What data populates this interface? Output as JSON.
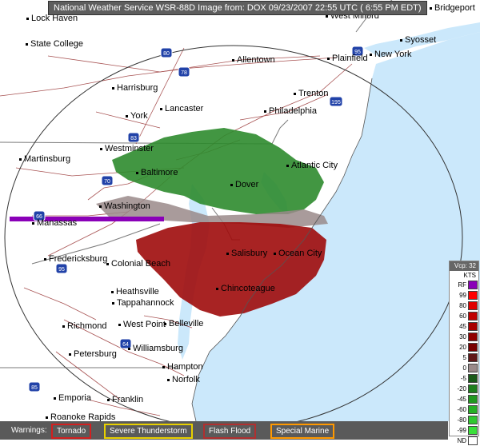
{
  "header": {
    "title": "National Weather Service WSR-88D Image from: DOX 09/23/2007  22:55 UTC ( 6:55 PM EDT)"
  },
  "cities": [
    {
      "name": "State College"
    },
    {
      "name": "Harrisburg"
    },
    {
      "name": "York"
    },
    {
      "name": "Lancaster"
    },
    {
      "name": "Allentown"
    },
    {
      "name": "Trenton"
    },
    {
      "name": "Philadelphia"
    },
    {
      "name": "Plainfield"
    },
    {
      "name": "New York"
    },
    {
      "name": "Syosset"
    },
    {
      "name": "Westminster"
    },
    {
      "name": "Martinsburg"
    },
    {
      "name": "Baltimore"
    },
    {
      "name": "Dover"
    },
    {
      "name": "Atlantic City"
    },
    {
      "name": "Washington"
    },
    {
      "name": "Manassas"
    },
    {
      "name": "Fredericksburg"
    },
    {
      "name": "Colonial Beach"
    },
    {
      "name": "Salisbury"
    },
    {
      "name": "Ocean City"
    },
    {
      "name": "Chincoteague"
    },
    {
      "name": "Heathsville"
    },
    {
      "name": "Tappahannock"
    },
    {
      "name": "Richmond"
    },
    {
      "name": "West Point"
    },
    {
      "name": "Belleville"
    },
    {
      "name": "Williamsburg"
    },
    {
      "name": "Petersburg"
    },
    {
      "name": "Hampton"
    },
    {
      "name": "Norfolk"
    },
    {
      "name": "Emporia"
    },
    {
      "name": "Franklin"
    },
    {
      "name": "Roanoke Rapids"
    },
    {
      "name": "West Milford"
    },
    {
      "name": "Bridgeport"
    },
    {
      "name": "Lock Haven"
    }
  ],
  "interstates": [
    "80",
    "78",
    "83",
    "70",
    "66",
    "95",
    "195",
    "64",
    "85",
    "95"
  ],
  "legend": {
    "title": "Vcp: 32",
    "units": "KTS",
    "entries": [
      {
        "label": "RF",
        "color": "#8a00b8"
      },
      {
        "label": "99",
        "color": "#ff0000"
      },
      {
        "label": "80",
        "color": "#e00000"
      },
      {
        "label": "60",
        "color": "#c00000"
      },
      {
        "label": "45",
        "color": "#a80000"
      },
      {
        "label": "30",
        "color": "#900000"
      },
      {
        "label": "20",
        "color": "#780000"
      },
      {
        "label": "5",
        "color": "#601818"
      },
      {
        "label": "0",
        "color": "#9a8a8a"
      },
      {
        "label": "-5",
        "color": "#1a5a1a"
      },
      {
        "label": "-20",
        "color": "#1f7f1f"
      },
      {
        "label": "-45",
        "color": "#229922"
      },
      {
        "label": "-60",
        "color": "#27b027"
      },
      {
        "label": "-80",
        "color": "#30c830"
      },
      {
        "label": "-99",
        "color": "#3ae03a"
      },
      {
        "label": "ND",
        "color": "#ffffff"
      }
    ]
  },
  "warnings": {
    "label": "Warnings:",
    "items": [
      {
        "label": "Tornado",
        "color": "#d22020"
      },
      {
        "label": "Severe Thunderstorm",
        "color": "#e8d000"
      },
      {
        "label": "Flash Flood",
        "color": "#b03030"
      },
      {
        "label": "Special Marine",
        "color": "#ff9900"
      }
    ]
  },
  "colors": {
    "land": "#ffffff",
    "water": "#cbe8fb",
    "roads": "#8b1a1a",
    "inbound_green": "#2d8b2d",
    "outbound_red": "#9e0b0b",
    "range_ring": "#333333"
  }
}
